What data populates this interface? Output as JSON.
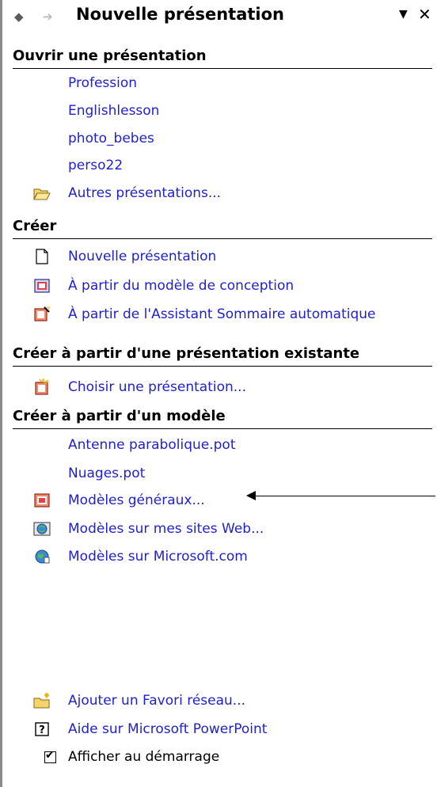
{
  "header": {
    "back_glyph": "◆",
    "forward_glyph": "➔",
    "title": "Nouvelle présentation",
    "dropdown_glyph": "▼",
    "close_glyph": "✕"
  },
  "open": {
    "heading": "Ouvrir une présentation",
    "recent": [
      "Profession",
      "Englishlesson",
      "photo_bebes",
      "perso22"
    ],
    "more": "Autres présentations..."
  },
  "create": {
    "heading": "Créer",
    "new": "Nouvelle présentation",
    "design": "À partir du modèle de conception",
    "wizard": "À partir de l'Assistant Sommaire automatique"
  },
  "existing": {
    "heading": "Créer à partir d'une présentation existante",
    "choose": "Choisir une présentation..."
  },
  "template": {
    "heading": "Créer à partir d'un modèle",
    "recent": [
      "Antenne parabolique.pot",
      "Nuages.pot"
    ],
    "general": "Modèles généraux...",
    "web": "Modèles sur mes sites Web...",
    "microsoft": "Modèles sur Microsoft.com"
  },
  "footer": {
    "add_network": "Ajouter un Favori réseau...",
    "help": "Aide sur Microsoft PowerPoint",
    "show_at_startup": "Afficher au démarrage",
    "show_at_startup_checked": true
  }
}
